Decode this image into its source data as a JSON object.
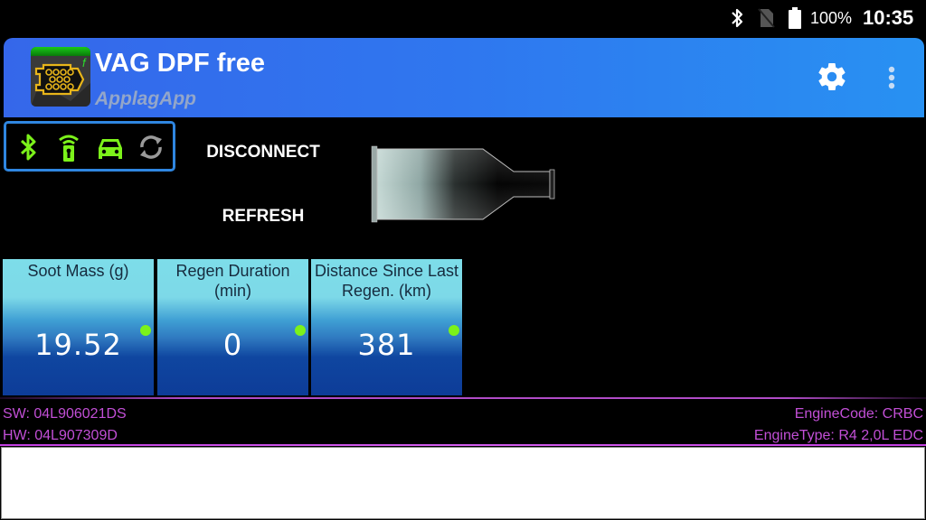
{
  "status_bar": {
    "icons": [
      "bluetooth-icon",
      "no-sim-icon",
      "battery-full-icon"
    ],
    "battery_percent": "100%",
    "time": "10:35"
  },
  "app_bar": {
    "title": "VAG DPF free",
    "subtitle": "ApplagApp",
    "icon": "dpf-filter-app-icon",
    "actions": [
      "settings-icon",
      "more-vert-icon"
    ]
  },
  "connection_status": {
    "icons": [
      {
        "name": "bluetooth-icon",
        "state": "active",
        "color": "#7cf21a"
      },
      {
        "name": "obd-adapter-icon",
        "state": "active",
        "color": "#7cf21a"
      },
      {
        "name": "car-icon",
        "state": "active",
        "color": "#7cf21a"
      },
      {
        "name": "sync-icon",
        "state": "inactive",
        "color": "#9a9a9a"
      }
    ],
    "border_color": "#2f86e0"
  },
  "actions": {
    "disconnect_label": "DISCONNECT",
    "refresh_label": "REFRESH"
  },
  "tiles": [
    {
      "label": "Soot Mass (g)",
      "value": "19.52",
      "indicator_color": "#7cf21a"
    },
    {
      "label": "Regen Duration (min)",
      "value": "0",
      "indicator_color": "#7cf21a"
    },
    {
      "label": "Distance Since Last Regen. (km)",
      "value": "381",
      "indicator_color": "#7cf21a"
    }
  ],
  "ecu_info": {
    "sw": "SW: 04L906021DS",
    "hw": "HW: 04L907309D",
    "engine_code": "EngineCode: CRBC",
    "engine_type": "EngineType: R4 2,0L EDC",
    "text_color": "#c24fd6"
  },
  "log": {
    "text": ""
  }
}
